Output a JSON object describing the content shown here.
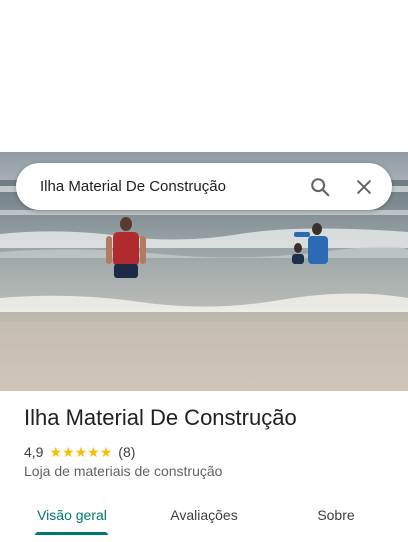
{
  "search": {
    "query": "Ilha Material De Construção"
  },
  "icons": {
    "search": "search-icon",
    "close": "close-icon"
  },
  "place": {
    "title": "Ilha Material De Construção",
    "rating": "4,9",
    "stars": 5,
    "review_count": "(8)",
    "category": "Loja de materiais de construção"
  },
  "tabs": [
    {
      "label": "Visão geral",
      "active": true
    },
    {
      "label": "Avaliações",
      "active": false
    },
    {
      "label": "Sobre",
      "active": false
    }
  ],
  "colors": {
    "accent": "#01796f",
    "star": "#fbbc04",
    "text": "#202124"
  }
}
